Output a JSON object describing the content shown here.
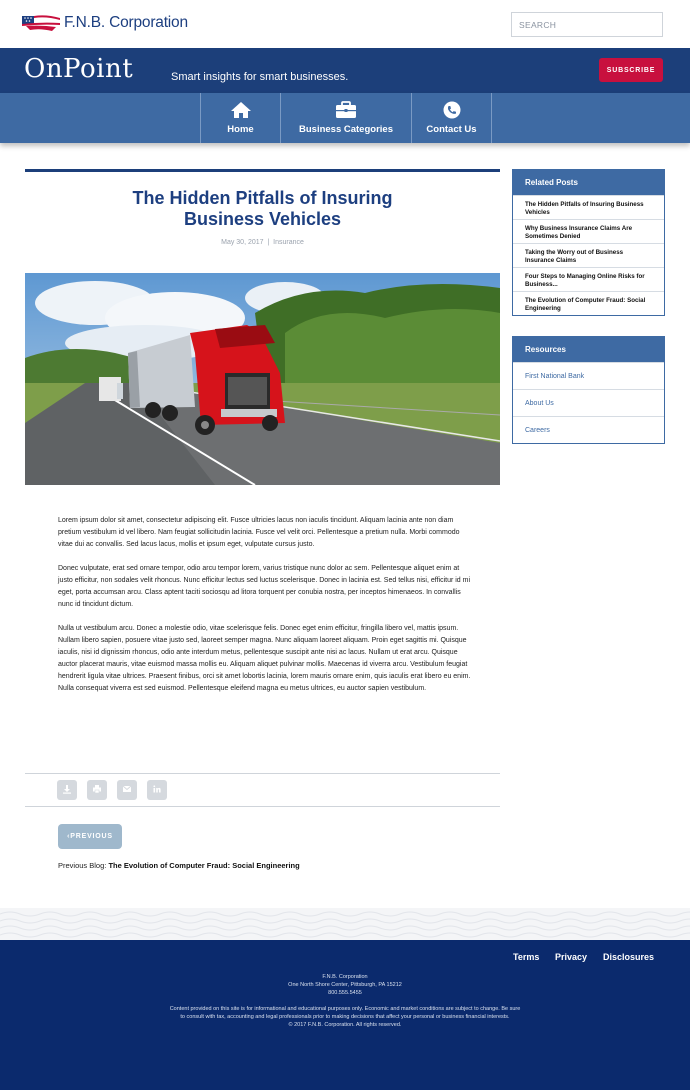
{
  "header": {
    "logo_text": "F.N.B. Corporation",
    "search_placeholder": "SEARCH"
  },
  "banner": {
    "brand": "OnPoint",
    "tagline": "Smart insights for smart businesses.",
    "subscribe_label": "SUBSCRIBE",
    "color": "#1c3f7a",
    "accent": "#c8103e"
  },
  "nav": {
    "items": [
      {
        "label": "Home",
        "icon": "home-icon"
      },
      {
        "label": "Business Categories",
        "icon": "briefcase-icon"
      },
      {
        "label": "Contact Us",
        "icon": "phone-icon"
      }
    ]
  },
  "article": {
    "title_line1": "The Hidden Pitfalls of Insuring",
    "title_line2": "Business Vehicles",
    "date": "May 30, 2017",
    "separator": "|",
    "category": "Insurance",
    "hero_image": "red-semi-truck-on-highway",
    "paragraphs": [
      "Lorem ipsum dolor sit amet, consectetur adipiscing elit. Fusce ultricies lacus non iaculis tincidunt. Aliquam lacinia ante non diam pretium vestibulum id vel libero. Nam feugiat sollicitudin lacinia. Fusce vel velit orci. Pellentesque a pretium nulla. Morbi commodo vitae dui ac convallis. Sed lacus lacus, mollis et ipsum eget, vulputate cursus justo.",
      "Donec vulputate, erat sed ornare tempor, odio arcu tempor lorem, varius tristique nunc dolor ac sem. Pellentesque aliquet enim at justo efficitur, non sodales velit rhoncus. Nunc efficitur lectus sed luctus scelerisque. Donec in lacinia est. Sed tellus nisi, efficitur id mi eget, porta accumsan arcu. Class aptent taciti sociosqu ad litora torquent per conubia nostra, per inceptos himenaeos. In convallis nunc id tincidunt dictum.",
      "Nulla ut vestibulum arcu. Donec a molestie odio, vitae scelerisque felis. Donec eget enim efficitur, fringilla libero vel, mattis ipsum. Nullam libero sapien, posuere vitae justo sed, laoreet semper magna. Nunc aliquam laoreet aliquam. Proin eget sagittis mi. Quisque iaculis, nisi id dignissim rhoncus, odio ante interdum metus, pellentesque suscipit ante nisi ac lacus. Nullam ut erat arcu. Quisque auctor placerat mauris, vitae euismod massa mollis eu. Aliquam aliquet pulvinar mollis. Maecenas id viverra arcu. Vestibulum feugiat hendrerit ligula vitae ultrices. Praesent finibus, orci sit amet lobortis lacinia, lorem mauris ornare enim, quis iaculis erat libero eu enim. Nulla consequat viverra est sed euismod. Pellentesque eleifend magna eu metus ultrices, eu auctor sapien vestibulum."
    ],
    "share_icons": [
      "download-icon",
      "print-icon",
      "email-icon",
      "linkedin-icon"
    ],
    "prev_button": "PREVIOUS",
    "prev_blog_label": "Previous Blog:",
    "prev_blog_title": "The Evolution of Computer Fraud: Social Engineering"
  },
  "sidebar": {
    "related_title": "Related Posts",
    "related_posts": [
      "The Hidden Pitfalls of Insuring Business Vehicles",
      "Why Business Insurance Claims Are Sometimes Denied",
      "Taking the Worry out of Business Insurance Claims",
      "Four Steps to Managing Online Risks for Business...",
      "The Evolution of Computer Fraud: Social Engineering"
    ],
    "resources_title": "Resources",
    "resources": [
      "First National Bank",
      "About Us",
      "Careers"
    ]
  },
  "footer": {
    "links": [
      "Terms",
      "Privacy",
      "Disclosures"
    ],
    "company": "F.N.B. Corporation",
    "address": "One North Shore Center, Pittsburgh, PA 15212",
    "phone": "800.555.5455",
    "disclaimer_line1": "Content provided on this site is for informational and educational purposes only. Economic and market conditions are subject to change. Be sure",
    "disclaimer_line2": "to consult with tax, accounting and legal professionals prior to making decisions that affect your personal or business financial interests.",
    "copyright": "© 2017 F.N.B. Corporation. All rights reserved.",
    "color": "#0b2a6d"
  }
}
